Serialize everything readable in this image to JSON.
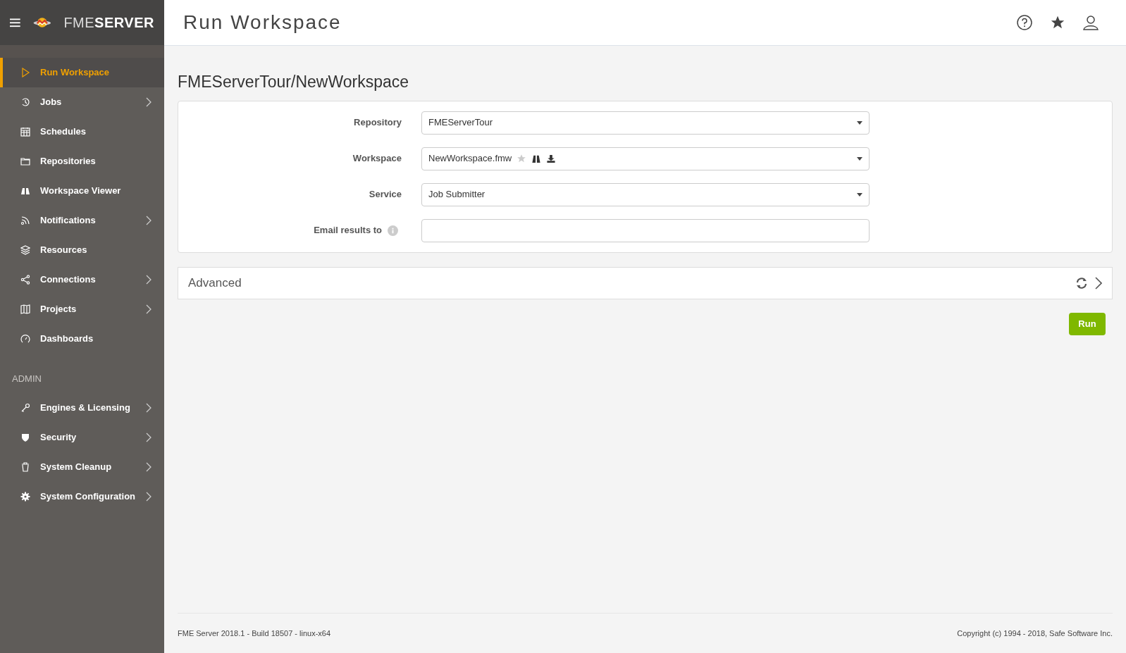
{
  "header": {
    "brand_light": "FME",
    "brand_bold": "SERVER",
    "title": "Run Workspace"
  },
  "sidebar": {
    "items": [
      {
        "label": "Run Workspace",
        "selected": true,
        "expandable": false
      },
      {
        "label": "Jobs",
        "selected": false,
        "expandable": true
      },
      {
        "label": "Schedules",
        "selected": false,
        "expandable": false
      },
      {
        "label": "Repositories",
        "selected": false,
        "expandable": false
      },
      {
        "label": "Workspace Viewer",
        "selected": false,
        "expandable": false
      },
      {
        "label": "Notifications",
        "selected": false,
        "expandable": true
      },
      {
        "label": "Resources",
        "selected": false,
        "expandable": false
      },
      {
        "label": "Connections",
        "selected": false,
        "expandable": true
      },
      {
        "label": "Projects",
        "selected": false,
        "expandable": true
      },
      {
        "label": "Dashboards",
        "selected": false,
        "expandable": false
      }
    ],
    "admin_heading": "ADMIN",
    "admin_items": [
      {
        "label": "Engines & Licensing",
        "selected": false,
        "expandable": true
      },
      {
        "label": "Security",
        "selected": false,
        "expandable": true
      },
      {
        "label": "System Cleanup",
        "selected": false,
        "expandable": true
      },
      {
        "label": "System Configuration",
        "selected": false,
        "expandable": true
      }
    ]
  },
  "page_heading": "FMEServerTour/NewWorkspace",
  "form": {
    "fields": [
      {
        "kind": "select",
        "label": "Repository",
        "value": "FMEServerTour"
      },
      {
        "kind": "workspace",
        "label": "Workspace",
        "value": "NewWorkspace.fmw"
      },
      {
        "kind": "select",
        "label": "Service",
        "value": "Job Submitter"
      },
      {
        "kind": "email",
        "label": "Email results to"
      }
    ]
  },
  "advanced": {
    "label": "Advanced",
    "expanded": false
  },
  "run_button": "Run",
  "footer": {
    "version": "FME Server 2018.1 - Build 18507 - linux-x64",
    "copyright": "Copyright (c) 1994 - 2018, Safe Software Inc."
  }
}
